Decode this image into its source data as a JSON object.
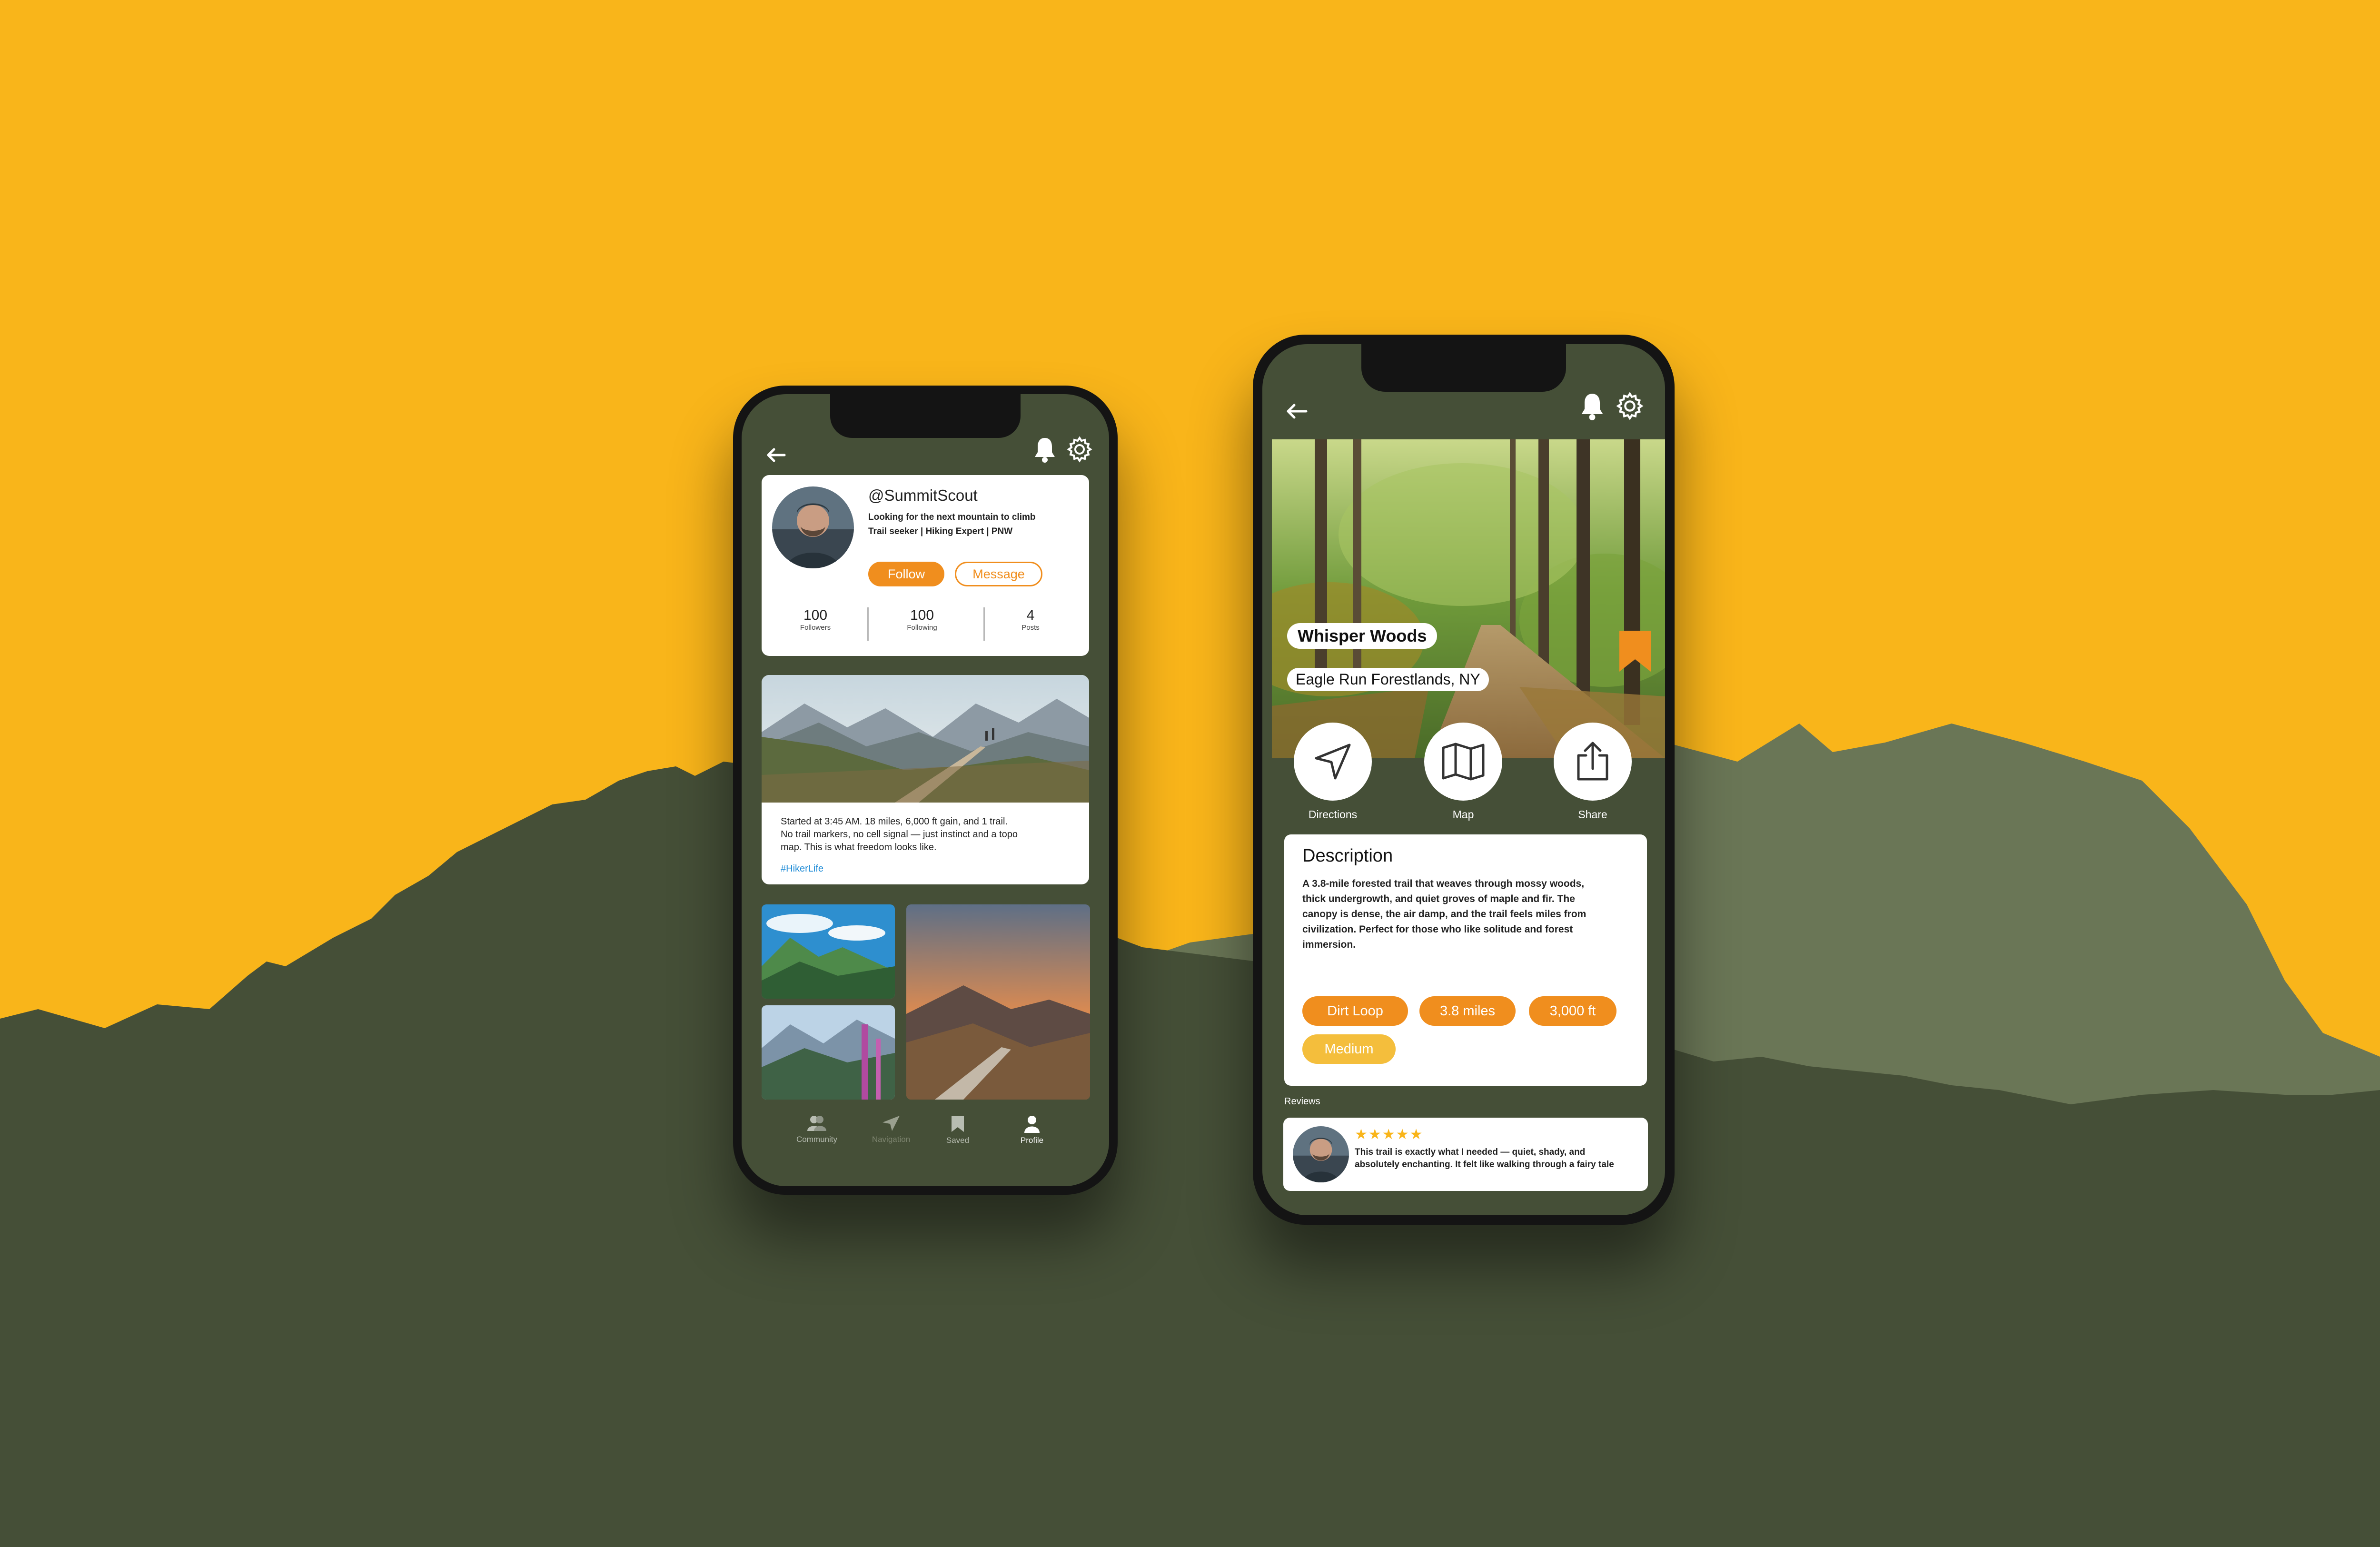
{
  "colors": {
    "background": "#F9B51A",
    "mountain_light": "#6A7656",
    "mountain_dark": "#454F37",
    "screen_bg": "#454F37",
    "accent_orange": "#F08E1E",
    "chip_yellow": "#F4BE3C",
    "hashtag_blue": "#1E8BD6"
  },
  "profile_screen": {
    "topbar": {
      "back_icon": "arrow-left-icon",
      "icons": [
        "bell-icon",
        "gear-icon"
      ]
    },
    "profile": {
      "handle": "@SummitScout",
      "bio_line1": "Looking for the next mountain to climb",
      "bio_line2": "Trail seeker | Hiking Expert | PNW",
      "follow_label": "Follow",
      "message_label": "Message",
      "stats": [
        {
          "value": "100",
          "label": "Followers"
        },
        {
          "value": "100",
          "label": "Following"
        },
        {
          "value": "4",
          "label": "Posts"
        }
      ]
    },
    "post": {
      "line1": "Started at 3:45 AM. 18 miles, 6,000 ft gain, and 1 trail.",
      "line2": "No trail markers, no cell signal — just instinct and a topo",
      "line3": "map. This is what freedom looks like.",
      "hashtag": "#HikerLife"
    },
    "nav": [
      {
        "label": "Community",
        "icon": "people-icon",
        "active": false
      },
      {
        "label": "Navigation",
        "icon": "navigation-arrow-icon",
        "active": false
      },
      {
        "label": "Saved",
        "icon": "bookmark-icon",
        "active": false
      },
      {
        "label": "Profile",
        "icon": "person-icon",
        "active": true
      }
    ]
  },
  "trail_screen": {
    "topbar": {
      "back_icon": "arrow-left-icon",
      "icons": [
        "bell-icon",
        "gear-icon"
      ]
    },
    "trail_name": "Whisper Woods",
    "location": "Eagle Run Forestlands, NY",
    "actions": [
      {
        "label": "Directions",
        "icon": "navigation-arrow-icon"
      },
      {
        "label": "Map",
        "icon": "map-icon"
      },
      {
        "label": "Share",
        "icon": "share-icon"
      }
    ],
    "description": {
      "title": "Description",
      "line1": "A 3.8-mile forested trail that weaves through mossy woods,",
      "line2": "thick undergrowth, and quiet groves of maple and fir. The",
      "line3": "canopy is dense, the air damp, and the trail feels miles from",
      "line4": "civilization. Perfect for those who like solitude and forest",
      "line5": "immersion."
    },
    "chips": [
      "Dirt Loop",
      "3.8 miles",
      "3,000 ft",
      "Medium"
    ],
    "reviews_label": "Reviews",
    "review": {
      "rating": 5,
      "stars": "★★★★★",
      "line1": "This trail is exactly what I needed — quiet, shady, and",
      "line2": "absolutely enchanting. It felt like walking through a fairy tale"
    }
  }
}
